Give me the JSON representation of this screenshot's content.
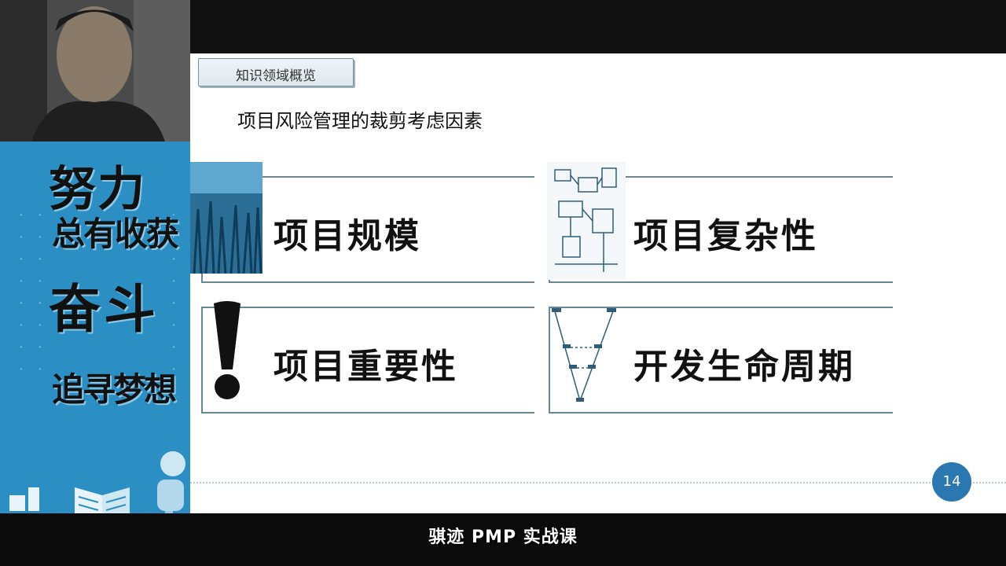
{
  "slide": {
    "section_tag": "知识领域概览",
    "title": "项目风险管理的裁剪考虑因素",
    "cards": [
      {
        "label": "项目规模",
        "icon": "grass-photo-icon"
      },
      {
        "label": "项目复杂性",
        "icon": "circuit-diagram-icon"
      },
      {
        "label": "项目重要性",
        "icon": "exclamation-icon"
      },
      {
        "label": "开发生命周期",
        "icon": "v-model-diagram-icon"
      }
    ],
    "page_number": "14"
  },
  "banner": {
    "line1": "努力",
    "line2": "总有收获",
    "line3": "奋斗",
    "line4": "追寻梦想"
  },
  "caption": "骐迹 PMP 实战课",
  "colors": {
    "accent": "#2b78b0",
    "banner": "#2b8fc4",
    "card_border": "#6b8796"
  }
}
